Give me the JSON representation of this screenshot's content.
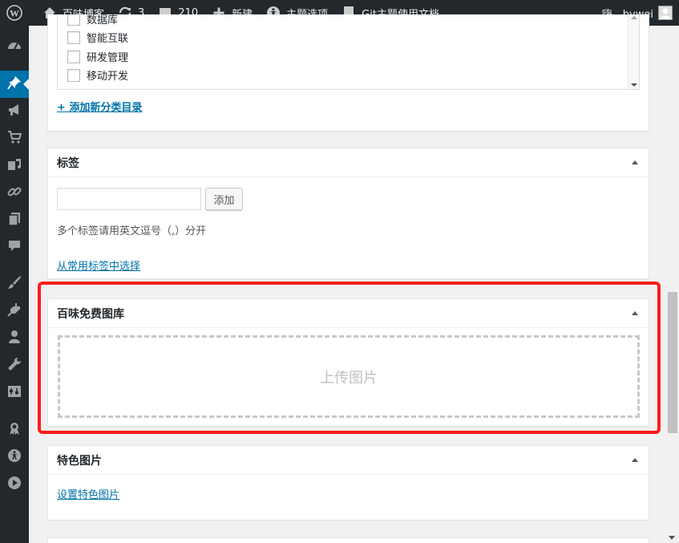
{
  "adminbar": {
    "site_name": "百味博客",
    "updates_count": "3",
    "comments_count": "210",
    "new_label": "新建",
    "theme_options_label": "主题选项",
    "git_docs_label": "Git主题使用文档",
    "greeting": "嗨，bywei"
  },
  "categories": {
    "items": [
      {
        "label": "数据库",
        "checked": false
      },
      {
        "label": "智能互联",
        "checked": false
      },
      {
        "label": "研发管理",
        "checked": false
      },
      {
        "label": "移动开发",
        "checked": false
      }
    ],
    "add_new_link": "+ 添加新分类目录"
  },
  "tags": {
    "title": "标签",
    "input_value": "",
    "add_button": "添加",
    "hint": "多个标签请用英文逗号（,）分开",
    "choose_link": "从常用标签中选择"
  },
  "gallery": {
    "title": "百味免费图库",
    "upload_label": "上传图片"
  },
  "featured": {
    "title": "特色图片",
    "set_link": "设置特色图片"
  },
  "colors": {
    "admin_bar": "#23282d",
    "active_menu": "#0073aa",
    "highlight": "#ff1a1a",
    "link": "#0073aa"
  }
}
